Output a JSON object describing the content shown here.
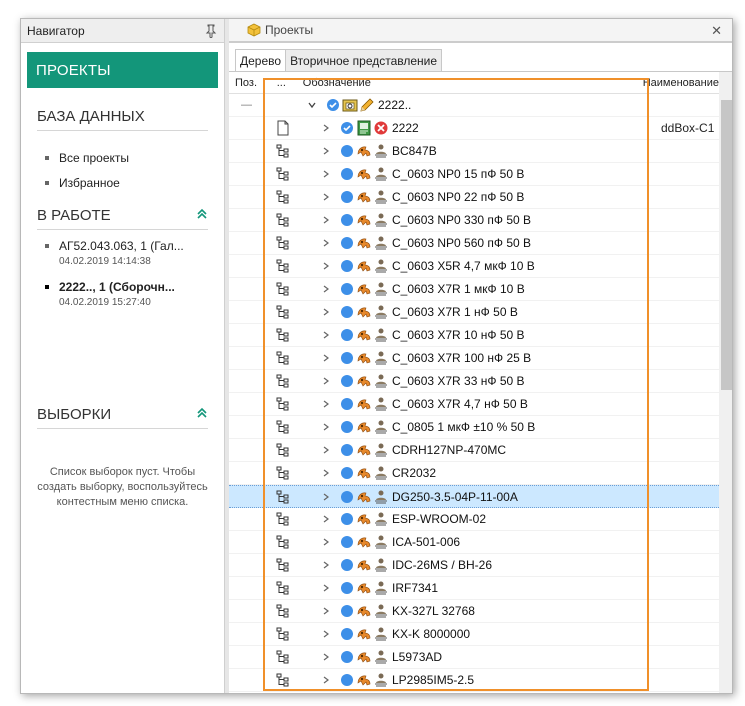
{
  "navigator": {
    "title": "Навигатор",
    "projects_label": "ПРОЕКТЫ",
    "database_title": "БАЗА ДАННЫХ",
    "database_items": [
      "Все проекты",
      "Избранное"
    ],
    "in_work_title": "В РАБОТЕ",
    "in_work_items": [
      {
        "title": "АГ52.043.063, 1 (Гал...",
        "date": "04.02.2019 14:14:38"
      },
      {
        "title": "2222.., 1 (Сборочн...",
        "date": "04.02.2019 15:27:40"
      }
    ],
    "selections_title": "ВЫБОРКИ",
    "selections_empty": "Список выборок пуст. Чтобы создать выборку, воспользуйтесь контестным меню списка."
  },
  "projects": {
    "tab_title": "Проекты",
    "subtabs": [
      "Дерево",
      "Вторичное представление"
    ],
    "columns": {
      "pos": "Поз.",
      "dots": "...",
      "designation": "Обозначение",
      "name": "Наименование"
    },
    "rows": [
      {
        "pos": "—",
        "label": "2222..",
        "name": "",
        "kind": "root"
      },
      {
        "pos": "",
        "label": "2222",
        "name": "ddBox-C1",
        "kind": "doc"
      },
      {
        "pos": "",
        "label": "BC847B",
        "name": "",
        "kind": "comp"
      },
      {
        "pos": "",
        "label": "C_0603 NP0 15 пФ 50 В",
        "name": "",
        "kind": "comp"
      },
      {
        "pos": "",
        "label": "C_0603 NP0 22 пФ 50 В",
        "name": "",
        "kind": "comp"
      },
      {
        "pos": "",
        "label": "C_0603 NP0 330 пФ 50 В",
        "name": "",
        "kind": "comp"
      },
      {
        "pos": "",
        "label": "C_0603 NP0 560 пФ 50 В",
        "name": "",
        "kind": "comp"
      },
      {
        "pos": "",
        "label": "C_0603 X5R 4,7 мкФ 10 В",
        "name": "",
        "kind": "comp"
      },
      {
        "pos": "",
        "label": "C_0603 X7R 1 мкФ 10 В",
        "name": "",
        "kind": "comp"
      },
      {
        "pos": "",
        "label": "C_0603 X7R 1 нФ 50 В",
        "name": "",
        "kind": "comp"
      },
      {
        "pos": "",
        "label": "C_0603 X7R 10 нФ 50 В",
        "name": "",
        "kind": "comp"
      },
      {
        "pos": "",
        "label": "C_0603 X7R 100 нФ 25 В",
        "name": "",
        "kind": "comp"
      },
      {
        "pos": "",
        "label": "C_0603 X7R 33 нФ 50 В",
        "name": "",
        "kind": "comp"
      },
      {
        "pos": "",
        "label": "C_0603 X7R 4,7 нФ 50 В",
        "name": "",
        "kind": "comp"
      },
      {
        "pos": "",
        "label": "C_0805 1 мкФ ±10 % 50 В",
        "name": "",
        "kind": "comp"
      },
      {
        "pos": "",
        "label": "CDRH127NP-470MC",
        "name": "",
        "kind": "comp"
      },
      {
        "pos": "",
        "label": "CR2032",
        "name": "",
        "kind": "comp"
      },
      {
        "pos": "",
        "label": "DG250-3.5-04P-11-00A",
        "name": "",
        "kind": "comp",
        "selected": true
      },
      {
        "pos": "",
        "label": "ESP-WROOM-02",
        "name": "",
        "kind": "comp"
      },
      {
        "pos": "",
        "label": "ICA-501-006",
        "name": "",
        "kind": "comp"
      },
      {
        "pos": "",
        "label": "IDC-26MS / BH-26",
        "name": "",
        "kind": "comp"
      },
      {
        "pos": "",
        "label": "IRF7341",
        "name": "",
        "kind": "comp"
      },
      {
        "pos": "",
        "label": "KX-327L 32768",
        "name": "",
        "kind": "comp"
      },
      {
        "pos": "",
        "label": "KX-K 8000000",
        "name": "",
        "kind": "comp"
      },
      {
        "pos": "",
        "label": "L5973AD",
        "name": "",
        "kind": "comp"
      },
      {
        "pos": "",
        "label": "LP2985IM5-2.5",
        "name": "",
        "kind": "comp"
      }
    ]
  },
  "colors": {
    "accent": "#13967a",
    "highlight": "#f0902a",
    "selected_row": "#cce8ff",
    "status_blue": "#3d8fe8"
  }
}
